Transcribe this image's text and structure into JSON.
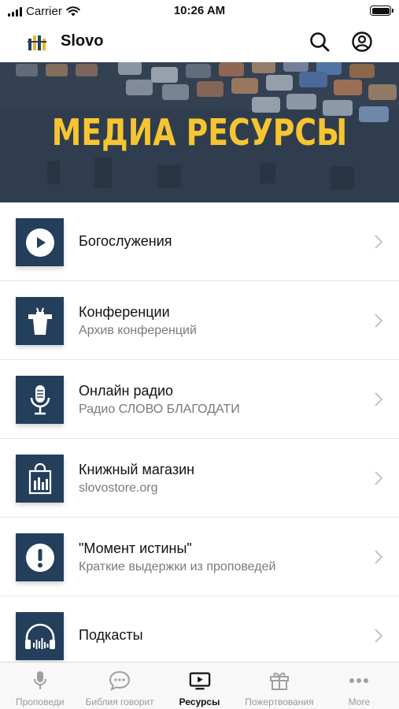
{
  "status_bar": {
    "carrier": "Carrier",
    "time": "10:26 AM"
  },
  "header": {
    "title": "Slovo"
  },
  "banner": {
    "title": "МЕДИА РЕСУРСЫ"
  },
  "items": [
    {
      "title": "Богослужения",
      "subtitle": "",
      "icon": "play-icon"
    },
    {
      "title": "Конференции",
      "subtitle": "Архив конференций",
      "icon": "podium-icon"
    },
    {
      "title": "Онлайн радио",
      "subtitle": "Радио СЛОВО БЛАГОДАТИ",
      "icon": "microphone-icon"
    },
    {
      "title": "Книжный магазин",
      "subtitle": "slovostore.org",
      "icon": "shopping-bag-icon"
    },
    {
      "title": "\"Момент истины\"",
      "subtitle": "Краткие выдержки из проповедей",
      "icon": "exclamation-icon"
    },
    {
      "title": "Подкасты",
      "subtitle": "",
      "icon": "headphones-icon"
    }
  ],
  "tabs": [
    {
      "label": "Проповеди",
      "icon": "microphone-icon",
      "active": false
    },
    {
      "label": "Библия говорит",
      "icon": "chat-bubble-icon",
      "active": false
    },
    {
      "label": "Ресурсы",
      "icon": "tv-play-icon",
      "active": true
    },
    {
      "label": "Пожертвования",
      "icon": "gift-icon",
      "active": false
    },
    {
      "label": "More",
      "icon": "more-dots-icon",
      "active": false
    }
  ],
  "colors": {
    "icon_tile": "#243f5b",
    "banner_title": "#f6c531",
    "active_tab": "#111111",
    "inactive_tab": "#9a9a9a"
  }
}
